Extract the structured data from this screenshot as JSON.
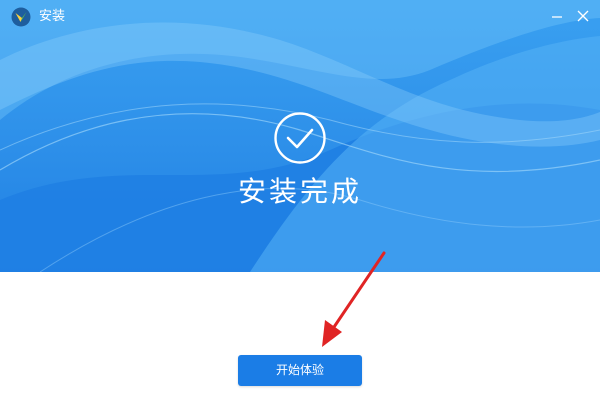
{
  "window": {
    "title": "安装",
    "minimize_icon": "minimize-icon",
    "close_icon": "close-icon",
    "logo_icon": "app-logo-icon"
  },
  "hero": {
    "status_icon": "checkmark-circle-icon",
    "status_text": "安装完成",
    "color": "#2d8fe9"
  },
  "actions": {
    "start_label": "开始体验",
    "start_color": "#1b7de6"
  },
  "annotation": {
    "icon": "red-arrow-icon",
    "color": "#e02424"
  }
}
